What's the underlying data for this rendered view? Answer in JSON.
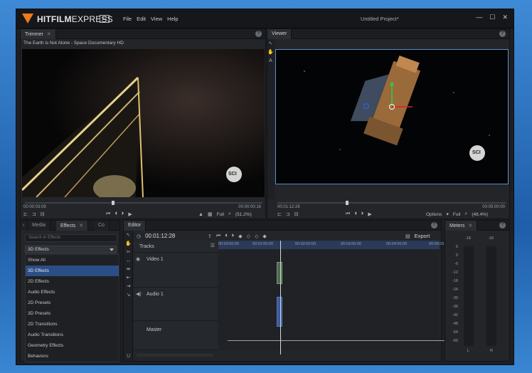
{
  "app": {
    "logo_text_a": "HITFILM",
    "logo_text_b": "EXPRESS",
    "logo_badge": "12",
    "menu": [
      "File",
      "Edit",
      "View",
      "Help"
    ],
    "window_title": "Untitled Project*",
    "window_controls": [
      "—",
      "☐",
      "✕"
    ]
  },
  "trimmer": {
    "tab": "Trimmer",
    "media_name": "The Earth is Not Alone - Space Documentary HD",
    "watermark": "SCI",
    "timecode_left": "00:00:03:09",
    "timecode_right": "00:00:00:16",
    "zoom_mode": "Full",
    "zoom_value": "(51.2%)"
  },
  "viewer": {
    "tab": "Viewer",
    "watermark": "SCI",
    "timecode_left": "00:01:12:28",
    "timecode_right": "00:05:00:00",
    "options_label": "Options",
    "zoom_mode": "Full",
    "zoom_value": "(48.4%)",
    "tool_text": "A"
  },
  "left_panel": {
    "tabs": [
      "Media",
      "Effects",
      "Co"
    ],
    "search_placeholder": "Search in Effects",
    "selected": "3D Effects",
    "items": [
      "Show All",
      "3D Effects",
      "2D Effects",
      "Audio Effects",
      "2D Presets",
      "3D Presets",
      "2D Transitions",
      "Audio Transitions",
      "Geometry Effects",
      "Behaviors"
    ]
  },
  "editor": {
    "tab": "Editor",
    "timecode": "00:01:12:28",
    "export_label": "Export",
    "tracks_label": "Tracks",
    "video_track": "Video 1",
    "audio_track": "Audio 1",
    "master_track": "Master",
    "ruler": [
      "00:00:00:00",
      "00:01:00:00",
      "00:02:00:00",
      "00:03:00:00",
      "00:04:00:00",
      "00:05:00:00"
    ]
  },
  "meters": {
    "tab": "Meters",
    "top_labels": [
      "-18",
      "-18"
    ],
    "scale": [
      "6",
      "0",
      "-6",
      "-12",
      "-18",
      "-24",
      "-30",
      "-36",
      "-42",
      "-48",
      "-54",
      "-60"
    ],
    "channels": [
      "L",
      "R"
    ]
  }
}
